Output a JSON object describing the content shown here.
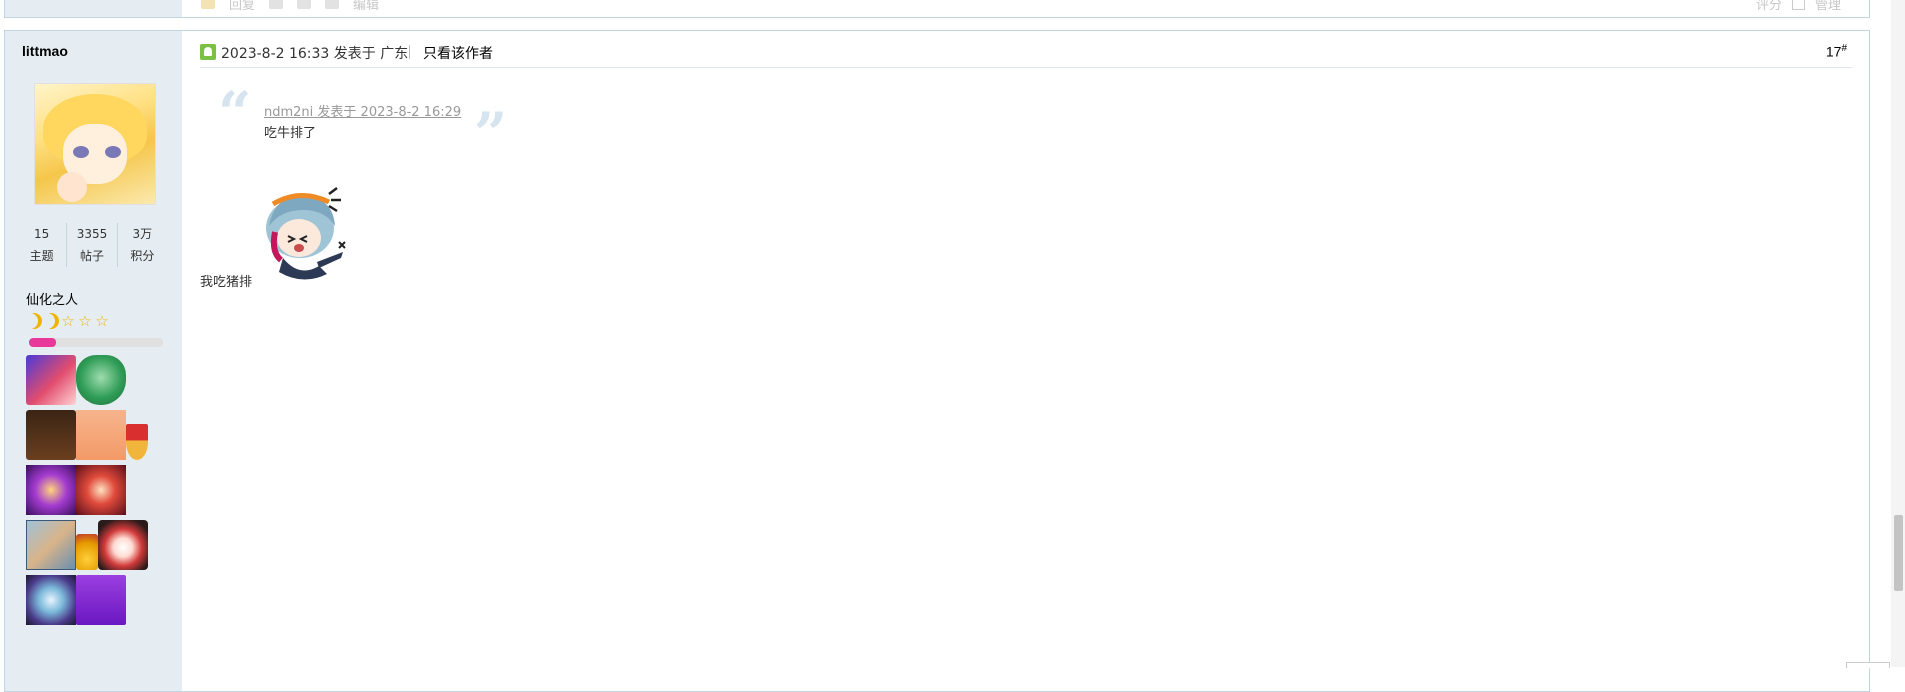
{
  "previous_post": {
    "reply_label": "回复",
    "edit_label": "编辑",
    "rate_label": "评分",
    "manage_label": "管理"
  },
  "author": {
    "name": "littmao",
    "stats": [
      {
        "value": "15",
        "label": "主题"
      },
      {
        "value": "3355",
        "label": "帖子"
      },
      {
        "value": "3万",
        "label": "积分"
      }
    ],
    "rank_title": "仙化之人",
    "level_icons": [
      "moon-icon",
      "moon-icon",
      "star-icon",
      "star-icon",
      "star-icon"
    ],
    "level_progress": 0.2,
    "medal_icons": [
      [
        "love-medal-icon",
        "green-shield-medal-icon"
      ],
      [
        "2022-youyuan-medal-icon",
        "bunny-medal-icon",
        "ribbon-medal-icon"
      ],
      [
        "purple-burst-medal-icon",
        "red-burst-medal-icon"
      ],
      [
        "map-medal-icon",
        "gold-small-medal-icon",
        "red-hair-girl-medal-icon"
      ],
      [
        "crystal-orb-medal-icon",
        "purple-banner-medal-icon"
      ]
    ]
  },
  "post": {
    "datetime": "2023-8-2 16:33",
    "posted_in_label": "发表于",
    "location": "广东",
    "only_author_label": "只看该作者",
    "floor_number": "17",
    "floor_mark": "#",
    "quote": {
      "source": "ndm2ni 发表于 2023-8-2 16:29",
      "text": "吃牛排了"
    },
    "body_text": "我吃猪排",
    "sticker_icon": "chibi-girl-sticker-icon"
  },
  "colors": {
    "sidebar_bg": "#e5edf2",
    "border": "#c2d5e3",
    "online_green": "#7ac143",
    "progress_pink": "#e8399a",
    "star_gold": "#f0b400"
  }
}
